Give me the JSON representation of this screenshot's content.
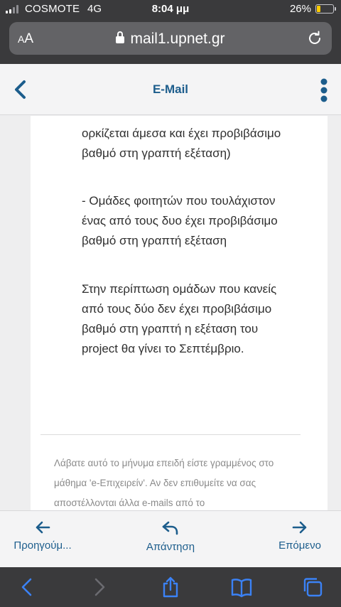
{
  "status": {
    "carrier": "COSMOTE",
    "network": "4G",
    "time": "8:04 μμ",
    "battery_percent": "26%",
    "battery_level": 0.26
  },
  "browser": {
    "aa_label_small": "A",
    "aa_label_big": "A",
    "url": "mail1.upnet.gr"
  },
  "header": {
    "title": "E-Mail"
  },
  "message": {
    "paragraphs": [
      "ορκίζεται άμεσα και έχει προβιβάσιμο βαθμό στη γραπτή εξέταση)",
      "- Ομάδες φοιτητών που τουλάχιστον ένας από τους δυο έχει προβιβάσιμο βαθμό στη γραπτή εξέταση",
      "Στην περίπτωση ομάδων που κανείς από τους δύο δεν έχει προβιβάσιμο βαθμό στη γραπτή η εξέταση του project θα γίνει το Σεπτέμβριο."
    ],
    "footer": "Λάβατε αυτό το μήνυμα επειδή είστε γραμμένος στο μάθημα 'e-Επιχειρείν'. Αν δεν επιθυμείτε να σας αποστέλλονται άλλα e-mails από το"
  },
  "toolbar": {
    "previous_label": "Προηγούμ...",
    "reply_label": "Απάντηση",
    "next_label": "Επόμενο"
  },
  "colors": {
    "accent": "#1c5d8c",
    "safari_chrome": "#3a3a3c",
    "safari_icon": "#3b82f6"
  }
}
